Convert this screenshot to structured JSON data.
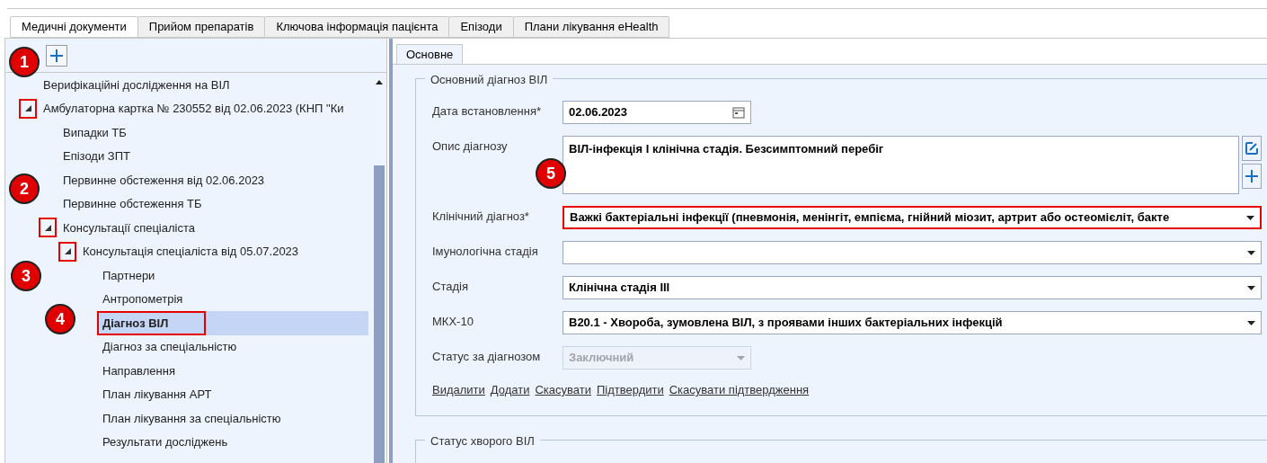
{
  "tabs": [
    {
      "label": "Медичні документи",
      "selected": true
    },
    {
      "label": "Прийом препаратів",
      "selected": false
    },
    {
      "label": "Ключова інформація пацієнта",
      "selected": false
    },
    {
      "label": "Епізоди",
      "selected": false
    },
    {
      "label": "Плани лікування eHealth",
      "selected": false
    }
  ],
  "tree": [
    {
      "label": "Верифікаційні дослідження на ВІЛ",
      "selected": false,
      "marked": false
    },
    {
      "label": "Амбулаторна картка № 230552 від 02.06.2023 (КНП \"Ки",
      "selected": false,
      "marked": true,
      "expanded": true,
      "children": [
        {
          "label": "Випадки ТБ",
          "selected": false,
          "marked": false
        },
        {
          "label": "Епізоди ЗПТ",
          "selected": false,
          "marked": false
        },
        {
          "label": "Первинне обстеження від 02.06.2023",
          "selected": false,
          "marked": false
        },
        {
          "label": "Первинне обстеження ТБ",
          "selected": false,
          "marked": false
        },
        {
          "label": "Консультації спеціаліста",
          "selected": false,
          "marked": true,
          "expanded": true,
          "children": [
            {
              "label": "Консультація спеціаліста від 05.07.2023",
              "selected": false,
              "marked": true,
              "expanded": true,
              "children": [
                {
                  "label": "Партнери",
                  "selected": false,
                  "marked": false
                },
                {
                  "label": "Антропометрія",
                  "selected": false,
                  "marked": false
                },
                {
                  "label": "Діагноз ВІЛ",
                  "selected": true,
                  "marked": true
                },
                {
                  "label": "Діагноз за спеціальністю",
                  "selected": false,
                  "marked": false
                },
                {
                  "label": "Направлення",
                  "selected": false,
                  "marked": false
                },
                {
                  "label": "План лікування АРТ",
                  "selected": false,
                  "marked": false
                },
                {
                  "label": "План лікування за спеціальністю",
                  "selected": false,
                  "marked": false
                },
                {
                  "label": "Результати досліджень",
                  "selected": false,
                  "marked": false
                }
              ]
            }
          ]
        }
      ]
    }
  ],
  "subtabs": [
    {
      "label": "Основне",
      "selected": true
    }
  ],
  "group": {
    "title": "Основний діагноз ВІЛ",
    "fields": [
      {
        "kind": "date",
        "label": "Дата встановлення*",
        "value": "02.06.2023",
        "marked": false,
        "disabled": false
      },
      {
        "kind": "memo",
        "label": "Опис діагнозу",
        "value": "ВІЛ-інфекція І клінічна стадія. Безсимптомний перебіг",
        "marked": false,
        "disabled": false
      },
      {
        "kind": "select",
        "label": "Клінічний діагноз*",
        "value": "Важкі бактеріальні інфекції (пневмонія, менінгіт, емпієма, гнійний міозит, артрит або остеомієліт, бакте",
        "marked": true,
        "disabled": false
      },
      {
        "kind": "select",
        "label": "Імунологічна стадія",
        "marked": false,
        "disabled": false
      },
      {
        "kind": "select",
        "label": "Стадія",
        "value": "Клінічна стадія III",
        "marked": false,
        "disabled": false
      },
      {
        "kind": "select",
        "label": "МКХ-10",
        "value": "B20.1 - Хвороба, зумовлена ВІЛ, з проявами інших бактеріальних інфекцій",
        "marked": false,
        "disabled": false
      },
      {
        "kind": "short",
        "label": "Статус за діагнозом",
        "value": "Заключний",
        "marked": false,
        "disabled": true
      }
    ],
    "links": [
      "Видалити",
      "Додати",
      "Скасувати",
      "Підтвердити",
      "Скасувати підтвердження"
    ]
  },
  "group2": {
    "title": "Статус хворого ВІЛ"
  },
  "callouts": [
    "1",
    "2",
    "3",
    "4",
    "5"
  ]
}
